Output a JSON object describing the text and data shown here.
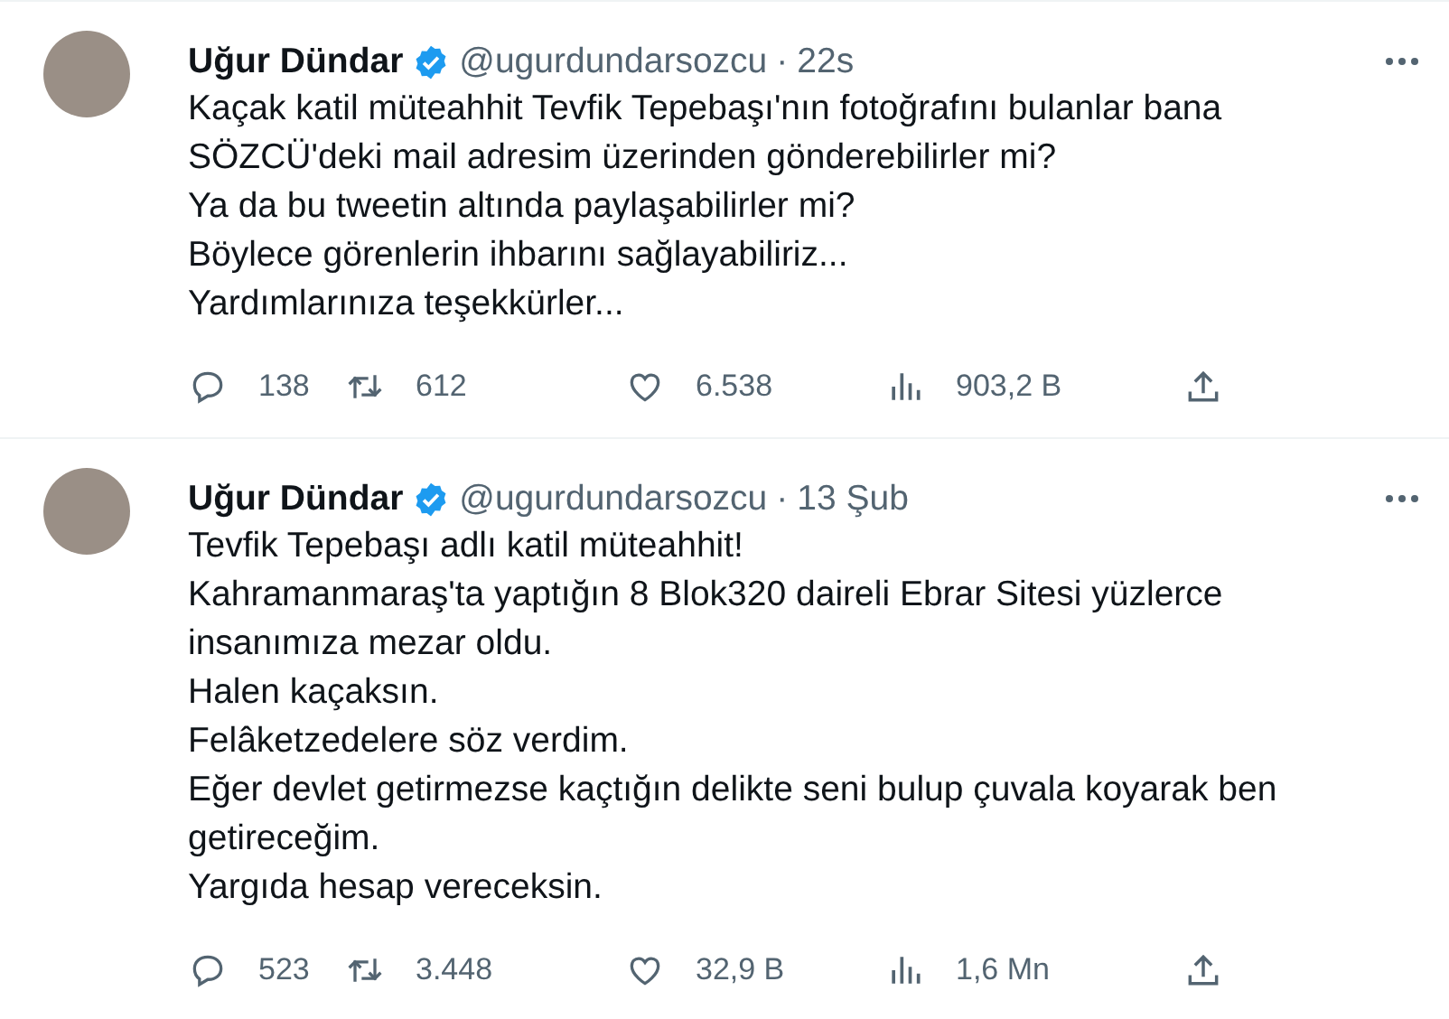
{
  "tweets": [
    {
      "name": "Uğur Dündar",
      "verified": true,
      "handle": "@ugurdundarsozcu",
      "separator": "·",
      "time": "22s",
      "lines": [
        "Kaçak katil müteahhit Tevfik Tepebaşı'nın fotoğrafını bulanlar  bana SÖZCÜ'deki mail adresim üzerinden gönderebilirler mi?",
        "Ya da bu tweetin altında paylaşabilirler mi?",
        "Böylece görenlerin ihbarını sağlayabiliriz...",
        "Yardımlarınıza teşekkürler..."
      ],
      "replies": "138",
      "retweets": "612",
      "likes": "6.538",
      "views": "903,2 B"
    },
    {
      "name": "Uğur Dündar",
      "verified": true,
      "handle": "@ugurdundarsozcu",
      "separator": "·",
      "time": "13 Şub",
      "lines": [
        "Tevfik Tepebaşı adlı katil müteahhit!",
        "Kahramanmaraş'ta yaptığın 8 Blok320 daireli Ebrar Sitesi yüzlerce insanımıza mezar oldu.",
        "Halen kaçaksın.",
        "Felâketzedelere söz verdim.",
        "Eğer devlet getirmezse kaçtığın delikte seni bulup çuvala koyarak ben getireceğim.",
        "Yargıda hesap vereceksin."
      ],
      "replies": "523",
      "retweets": "3.448",
      "likes": "32,9 B",
      "views": "1,6 Mn"
    }
  ]
}
